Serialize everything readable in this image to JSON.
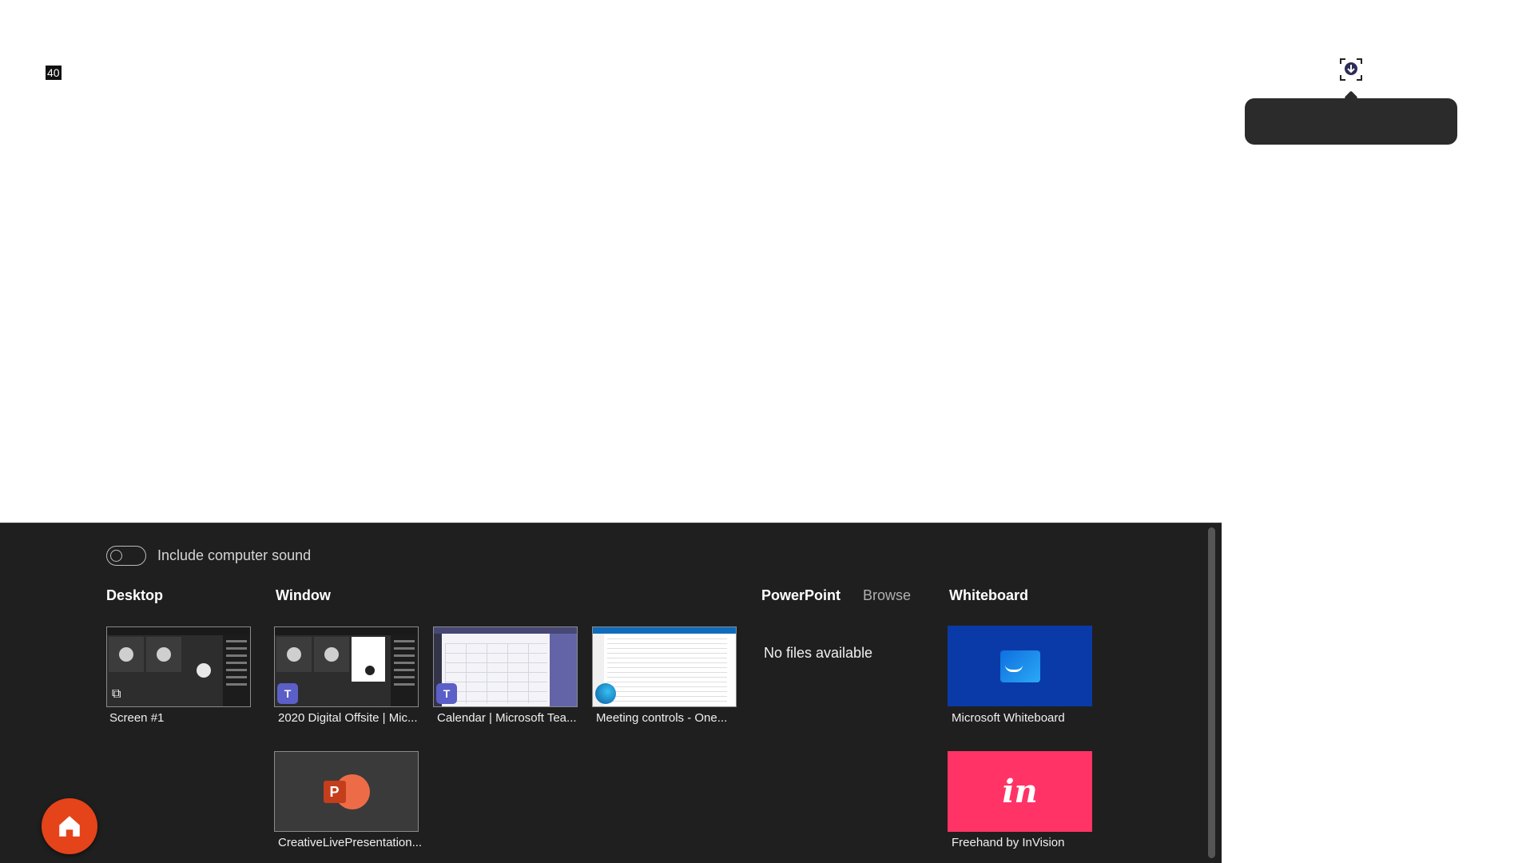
{
  "badge": {
    "text": "40"
  },
  "share": {
    "include_sound_label": "Include computer sound",
    "sections": {
      "desktop": "Desktop",
      "window": "Window",
      "powerpoint": "PowerPoint",
      "browse": "Browse",
      "whiteboard": "Whiteboard"
    },
    "desktop_items": [
      {
        "label": "Screen #1",
        "icon": "monitor-share-icon"
      }
    ],
    "window_items": [
      {
        "label": "2020 Digital Offsite | Mic...",
        "icon": "teams-icon"
      },
      {
        "label": "Calendar | Microsoft Tea...",
        "icon": "teams-icon"
      },
      {
        "label": "Meeting controls - One...",
        "icon": "edge-icon"
      },
      {
        "label": "CreativeLivePresentation...",
        "icon": "powerpoint-icon"
      }
    ],
    "powerpoint_empty": "No files available",
    "whiteboard_items": [
      {
        "label": "Microsoft Whiteboard",
        "icon": "whiteboard-icon"
      },
      {
        "label": "Freehand by InVision",
        "icon": "invision-icon",
        "logo_text": "in"
      }
    ]
  },
  "icons": {
    "teams_letter": "T",
    "ppt_letter": "P"
  },
  "colors": {
    "panel_bg": "#1f1f1f",
    "home_button": "#e5431a",
    "whiteboard_bg": "#0a3aa8",
    "invision_bg": "#ff3366",
    "teams": "#5b5fc7"
  }
}
